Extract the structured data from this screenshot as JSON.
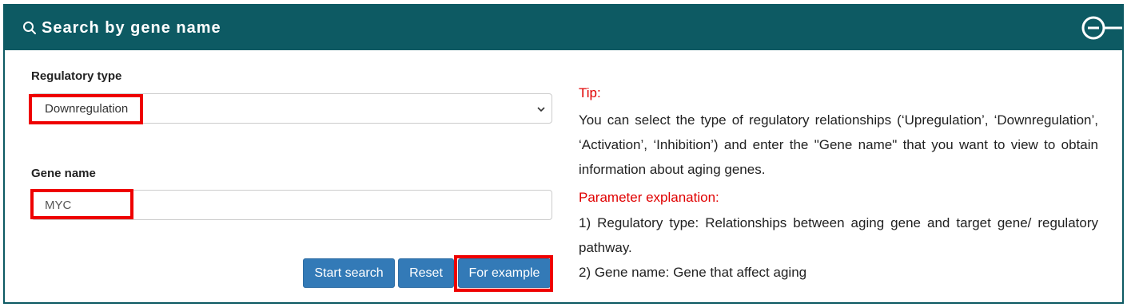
{
  "header": {
    "title": "Search by gene name"
  },
  "form": {
    "regulatory_type_label": "Regulatory type",
    "regulatory_type_value": "Downregulation",
    "gene_name_label": "Gene name",
    "gene_name_value": "MYC"
  },
  "buttons": {
    "start_search": "Start search",
    "reset": "Reset",
    "for_example": "For example"
  },
  "tip": {
    "title": "Tip:",
    "body": "You can select the type of regulatory relationships (‘Upregulation’, ‘Downregulation’, ‘Activation’, ‘Inhibition’) and enter the \"Gene name\" that you want to view to obtain information about aging genes."
  },
  "params": {
    "title": "Parameter explanation:",
    "item1": "1) Regulatory type: Relationships between aging gene and target gene/ regulatory pathway.",
    "item2": "2) Gene name: Gene that affect aging"
  },
  "colors": {
    "header_bg": "#0d5a63",
    "accent_red": "#ee0000",
    "button_blue": "#337ab7"
  },
  "icons": {
    "header": "search-icon",
    "collapse": "minus-circle-icon",
    "select": "chevron-down-icon"
  }
}
